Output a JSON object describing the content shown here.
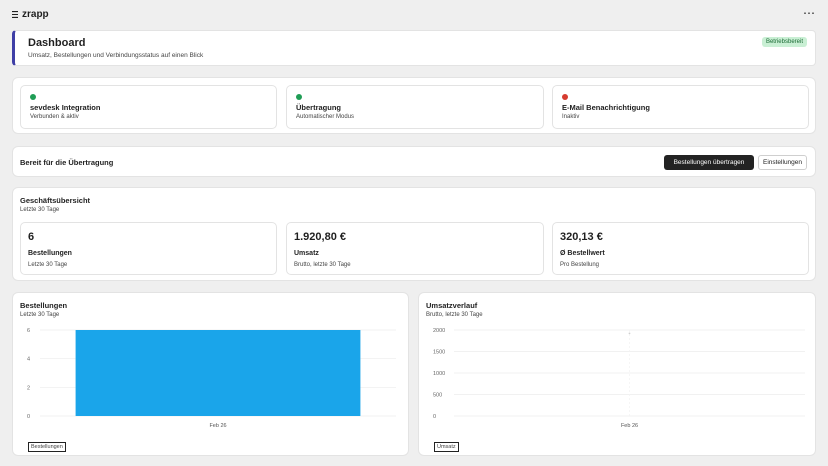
{
  "app": {
    "name": "zrapp",
    "menu_glyph": "⋯"
  },
  "header": {
    "title": "Dashboard",
    "subtitle": "Umsatz, Bestellungen und Verbindungsstatus auf einen Blick",
    "badge": "Betriebsbereit",
    "accent_color": "#3f3fa6"
  },
  "status_cards": [
    {
      "title": "sevdesk Integration",
      "subtitle": "Verbunden & aktiv",
      "status_color": "#1f9d55"
    },
    {
      "title": "Übertragung",
      "subtitle": "Automatischer Modus",
      "status_color": "#1f9d55"
    },
    {
      "title": "E-Mail Benachrichtigung",
      "subtitle": "Inaktiv",
      "status_color": "#d63b2f"
    }
  ],
  "actions": {
    "label": "Bereit für die Übertragung",
    "primary_button": "Bestellungen übertragen",
    "secondary_button": "Einstellungen"
  },
  "business": {
    "title": "Geschäftsübersicht",
    "subtitle": "Letzte 30 Tage",
    "kpis": [
      {
        "value": "6",
        "label": "Bestellungen",
        "sub": "Letzte 30 Tage"
      },
      {
        "value": "1.920,80 €",
        "label": "Umsatz",
        "sub": "Brutto, letzte 30 Tage"
      },
      {
        "value": "320,13 €",
        "label": "Ø Bestellwert",
        "sub": "Pro Bestellung"
      }
    ]
  },
  "charts": {
    "orders": {
      "title": "Bestellungen",
      "subtitle": "Letzte 30 Tage",
      "legend": "Bestellungen"
    },
    "revenue": {
      "title": "Umsatzverlauf",
      "subtitle": "Brutto, letzte 30 Tage",
      "legend": "Umsatz"
    }
  },
  "chart_data": [
    {
      "type": "bar",
      "categories": [
        "Feb 26"
      ],
      "series": [
        {
          "name": "Bestellungen",
          "values": [
            6
          ]
        }
      ],
      "ylim": [
        0,
        6
      ],
      "yticks": [
        0,
        2,
        4,
        6
      ],
      "grid": true,
      "bar_color": "#1aa5ea"
    },
    {
      "type": "line",
      "categories": [
        "Feb 26"
      ],
      "series": [
        {
          "name": "Umsatz",
          "values": [
            1920.8
          ]
        }
      ],
      "ylim": [
        0,
        2000
      ],
      "yticks": [
        0,
        500,
        1000,
        1500,
        2000
      ],
      "grid": true,
      "line_color": "#cfcfcf"
    }
  ]
}
